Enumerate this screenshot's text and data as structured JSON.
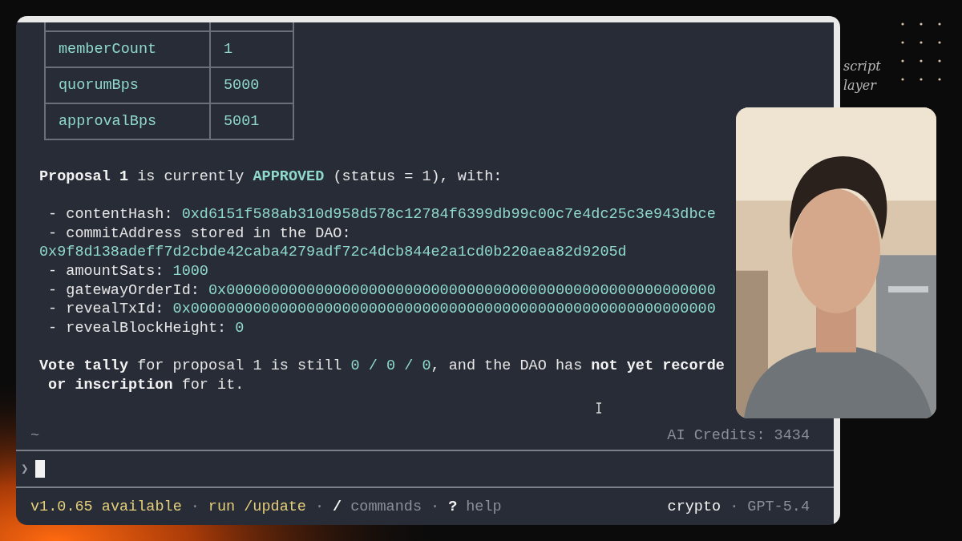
{
  "table": {
    "rows": [
      {
        "key": "memberCount",
        "value": "1"
      },
      {
        "key": "quorumBps",
        "value": "5000"
      },
      {
        "key": "approvalBps",
        "value": "5001"
      }
    ]
  },
  "summary": [
    {
      "text": "Proposal 1",
      "kind": "bold"
    },
    {
      "text": " is currently ",
      "kind": "plain"
    },
    {
      "text": "APPROVED",
      "kind": "accent-bold"
    },
    {
      "text": " (status = 1), with:",
      "kind": "plain"
    }
  ],
  "fields": [
    {
      "kind": "inline",
      "label": " - contentHash: ",
      "value": "0xd6151f588ab310d958d578c12784f6399db99c00c7e4dc25c3e943dbce"
    },
    {
      "kind": "wrapped",
      "label": " - commitAddress stored in the DAO:",
      "value": "0x9f8d138adeff7d2cbde42caba4279adf72c4dcb844e2a1cd0b220aea82d9205d"
    },
    {
      "kind": "inline",
      "label": " - amountSats: ",
      "value": "1000"
    },
    {
      "kind": "inline",
      "label": " - gatewayOrderId: ",
      "value": "0x0000000000000000000000000000000000000000000000000000000"
    },
    {
      "kind": "inline",
      "label": " - revealTxId: ",
      "value": "0x00000000000000000000000000000000000000000000000000000000000"
    },
    {
      "kind": "inline",
      "label": " - revealBlockHeight: ",
      "value": "0"
    }
  ],
  "tally": [
    [
      {
        "text": "Vote tally",
        "kind": "bold"
      },
      {
        "text": " for proposal 1 is still ",
        "kind": "plain"
      },
      {
        "text": "0 / 0 / 0",
        "kind": "accent"
      },
      {
        "text": ", and the DAO has ",
        "kind": "plain"
      },
      {
        "text": "not yet recorde",
        "kind": "bold"
      }
    ],
    [
      {
        "text": " or inscription",
        "kind": "bold"
      },
      {
        "text": " for it.",
        "kind": "plain"
      }
    ]
  ],
  "status": {
    "cwd": "~",
    "credits": "AI Credits: 3434"
  },
  "prompt": {
    "symbol": "❯"
  },
  "footer": {
    "left": [
      {
        "text": "v1.0.65 available",
        "kind": "update"
      },
      {
        "text": "·",
        "kind": "sep"
      },
      {
        "text": "run /update",
        "kind": "update"
      },
      {
        "text": "·",
        "kind": "sep"
      },
      {
        "text": "/",
        "kind": "key"
      },
      {
        "text": "commands",
        "kind": "hint"
      },
      {
        "text": "·",
        "kind": "sep"
      },
      {
        "text": "?",
        "kind": "key"
      },
      {
        "text": "help",
        "kind": "hint"
      }
    ],
    "right": [
      {
        "text": "crypto",
        "kind": "key"
      },
      {
        "text": "·",
        "kind": "sep"
      },
      {
        "text": "GPT-5.4",
        "kind": "hint"
      }
    ]
  },
  "backdrop": {
    "notes": [
      "script",
      "layer"
    ]
  },
  "webcam": {
    "kind": "picture"
  }
}
